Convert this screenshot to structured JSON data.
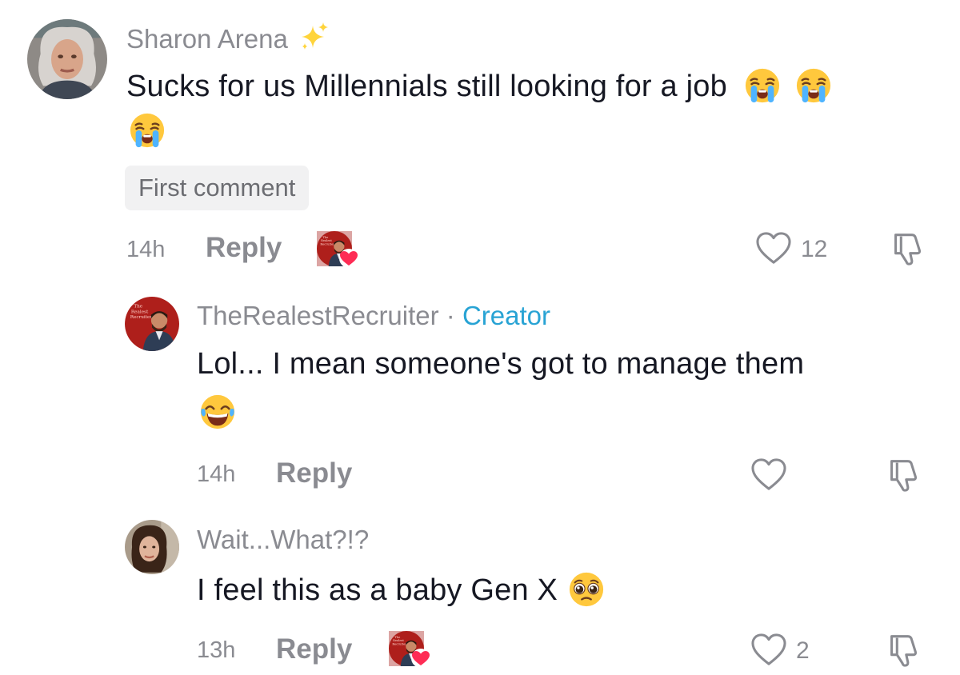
{
  "comments": [
    {
      "username": "Sharon Arena",
      "username_emoji": "sparkles",
      "text": "Sucks for us Millennials still looking for a job",
      "badge": "First comment",
      "time": "14h",
      "reply_label": "Reply",
      "creator_liked": true,
      "likes": "12"
    },
    {
      "username": "TheRealestRecruiter",
      "separator": "·",
      "role": "Creator",
      "text": "Lol... I mean someone's got to manage them",
      "time": "14h",
      "reply_label": "Reply",
      "creator_liked": false,
      "likes": ""
    },
    {
      "username": "Wait...What?!?",
      "text": "I feel this as a baby Gen X",
      "time": "13h",
      "reply_label": "Reply",
      "creator_liked": true,
      "likes": "2"
    }
  ],
  "icons": {
    "like": "heart-outline-icon",
    "dislike": "thumbs-down-icon",
    "creator_like": "creator-heart-badge"
  },
  "colors": {
    "username": "#8a8b91",
    "text": "#161823",
    "creator": "#28a3d4",
    "heart_badge": "#fe2c55",
    "badge_bg": "#f1f1f2"
  }
}
